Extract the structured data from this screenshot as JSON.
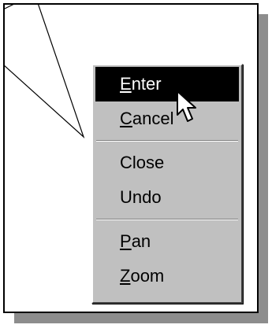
{
  "context_menu": {
    "groups": [
      [
        {
          "name": "enter",
          "accel": "E",
          "rest": "nter",
          "active": true
        },
        {
          "name": "cancel",
          "accel": "C",
          "rest": "ancel",
          "active": false
        }
      ],
      [
        {
          "name": "close",
          "accel": "",
          "rest": "Close",
          "active": false
        },
        {
          "name": "undo",
          "accel": "",
          "rest": "Undo",
          "active": false
        }
      ],
      [
        {
          "name": "pan",
          "accel": "P",
          "rest": "an",
          "active": false
        },
        {
          "name": "zoom",
          "accel": "Z",
          "rest": "oom",
          "active": false
        }
      ]
    ]
  },
  "icons": {
    "cursor": "arrow-pointer-icon"
  }
}
